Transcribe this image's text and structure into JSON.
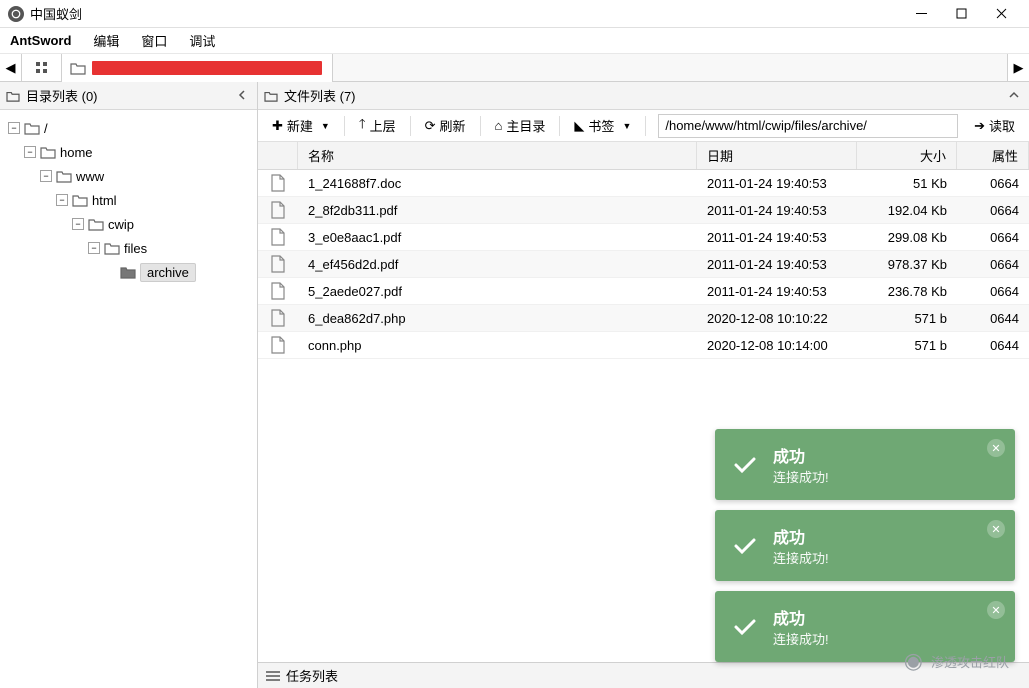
{
  "window": {
    "title": "中国蚁剑"
  },
  "menu": {
    "app": "AntSword",
    "edit": "编辑",
    "window": "窗口",
    "debug": "调试"
  },
  "sidebar": {
    "title": "目录列表 (0)",
    "nodes": [
      {
        "depth": 0,
        "label": "/",
        "expanded": true
      },
      {
        "depth": 1,
        "label": "home",
        "expanded": true
      },
      {
        "depth": 2,
        "label": "www",
        "expanded": true
      },
      {
        "depth": 3,
        "label": "html",
        "expanded": true
      },
      {
        "depth": 4,
        "label": "cwip",
        "expanded": true
      },
      {
        "depth": 5,
        "label": "files",
        "expanded": true
      },
      {
        "depth": 6,
        "label": "archive",
        "expanded": false,
        "selected": true,
        "leaf": true
      }
    ]
  },
  "filelist": {
    "title": "文件列表 (7)",
    "toolbar": {
      "new": "新建",
      "up": "上层",
      "refresh": "刷新",
      "home": "主目录",
      "bookmark": "书签",
      "read": "读取"
    },
    "path": "/home/www/html/cwip/files/archive/",
    "columns": {
      "name": "名称",
      "date": "日期",
      "size": "大小",
      "perm": "属性"
    },
    "rows": [
      {
        "icon": "doc",
        "name": "1_241688f7.doc",
        "date": "2011-01-24 19:40:53",
        "size": "51 Kb",
        "perm": "0664"
      },
      {
        "icon": "pdf",
        "name": "2_8f2db311.pdf",
        "date": "2011-01-24 19:40:53",
        "size": "192.04 Kb",
        "perm": "0664"
      },
      {
        "icon": "pdf",
        "name": "3_e0e8aac1.pdf",
        "date": "2011-01-24 19:40:53",
        "size": "299.08 Kb",
        "perm": "0664"
      },
      {
        "icon": "pdf",
        "name": "4_ef456d2d.pdf",
        "date": "2011-01-24 19:40:53",
        "size": "978.37 Kb",
        "perm": "0664"
      },
      {
        "icon": "pdf",
        "name": "5_2aede027.pdf",
        "date": "2011-01-24 19:40:53",
        "size": "236.78 Kb",
        "perm": "0664"
      },
      {
        "icon": "php",
        "name": "6_dea862d7.php",
        "date": "2020-12-08 10:10:22",
        "size": "571 b",
        "perm": "0644"
      },
      {
        "icon": "php",
        "name": "conn.php",
        "date": "2020-12-08 10:14:00",
        "size": "571 b",
        "perm": "0644"
      }
    ]
  },
  "taskbar": {
    "title": "任务列表"
  },
  "toasts": [
    {
      "title": "成功",
      "msg": "连接成功!"
    },
    {
      "title": "成功",
      "msg": "连接成功!"
    },
    {
      "title": "成功",
      "msg": "连接成功!"
    }
  ],
  "watermark": "渗透攻击红队"
}
